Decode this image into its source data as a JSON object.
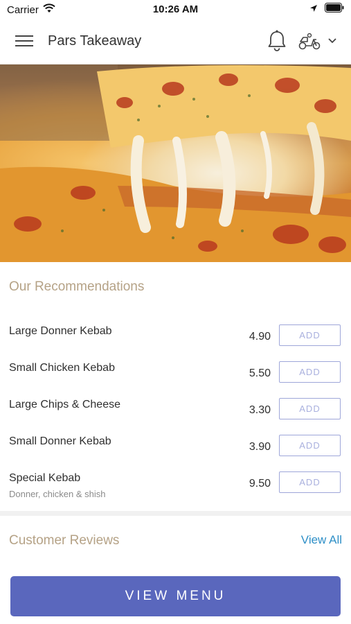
{
  "status_bar": {
    "carrier": "Carrier",
    "time": "10:26 AM",
    "icons": [
      "wifi-icon",
      "location-arrow-icon",
      "battery-icon"
    ]
  },
  "header": {
    "title": "Pars Takeaway",
    "icons": [
      "menu-icon",
      "bell-icon",
      "scooter-icon",
      "chevron-down-icon"
    ]
  },
  "hero": {
    "image": "pizza-cheese-pull"
  },
  "recommendations": {
    "title": "Our Recommendations",
    "add_label": "ADD",
    "items": [
      {
        "name": "Large Donner Kebab",
        "price": "4.90",
        "description": ""
      },
      {
        "name": "Small Chicken Kebab",
        "price": "5.50",
        "description": ""
      },
      {
        "name": "Large Chips & Cheese",
        "price": "3.30",
        "description": ""
      },
      {
        "name": "Small Donner Kebab",
        "price": "3.90",
        "description": ""
      },
      {
        "name": "Special Kebab",
        "price": "9.50",
        "description": "Donner, chicken & shish"
      }
    ]
  },
  "reviews": {
    "title": "Customer Reviews",
    "view_all": "View All"
  },
  "cta": {
    "label": "VIEW MENU"
  },
  "colors": {
    "accent": "#5a67bd",
    "section_title": "#b5a286",
    "link": "#2e8fc7",
    "add_border": "#9ea6d9"
  }
}
